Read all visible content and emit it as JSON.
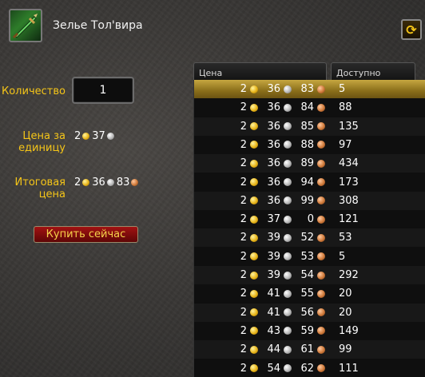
{
  "item": {
    "name": "Зелье Тол'вира",
    "icon": "dagger-icon"
  },
  "form": {
    "quantity_label": "Количество",
    "quantity_value": "1",
    "unit_price_label_1": "Цена за",
    "unit_price_label_2": "единицу",
    "unit_price": {
      "gold": "2",
      "silver": "37"
    },
    "total_label_1": "Итоговая",
    "total_label_2": "цена",
    "total_price": {
      "gold": "2",
      "silver": "36",
      "copper": "83"
    },
    "buy_label": "Купить сейчас"
  },
  "table": {
    "headers": {
      "price": "Цена",
      "available": "Доступно"
    },
    "rows": [
      {
        "gold": "2",
        "silver": "36",
        "copper": "83",
        "available": "5"
      },
      {
        "gold": "2",
        "silver": "36",
        "copper": "84",
        "available": "88"
      },
      {
        "gold": "2",
        "silver": "36",
        "copper": "85",
        "available": "135"
      },
      {
        "gold": "2",
        "silver": "36",
        "copper": "88",
        "available": "97"
      },
      {
        "gold": "2",
        "silver": "36",
        "copper": "89",
        "available": "434"
      },
      {
        "gold": "2",
        "silver": "36",
        "copper": "94",
        "available": "173"
      },
      {
        "gold": "2",
        "silver": "36",
        "copper": "99",
        "available": "308"
      },
      {
        "gold": "2",
        "silver": "37",
        "copper": "0",
        "available": "121"
      },
      {
        "gold": "2",
        "silver": "39",
        "copper": "52",
        "available": "53"
      },
      {
        "gold": "2",
        "silver": "39",
        "copper": "53",
        "available": "5"
      },
      {
        "gold": "2",
        "silver": "39",
        "copper": "54",
        "available": "292"
      },
      {
        "gold": "2",
        "silver": "41",
        "copper": "55",
        "available": "20"
      },
      {
        "gold": "2",
        "silver": "41",
        "copper": "56",
        "available": "20"
      },
      {
        "gold": "2",
        "silver": "43",
        "copper": "59",
        "available": "149"
      },
      {
        "gold": "2",
        "silver": "44",
        "copper": "61",
        "available": "99"
      },
      {
        "gold": "2",
        "silver": "54",
        "copper": "62",
        "available": "111"
      }
    ],
    "selected_row": 0
  },
  "colors": {
    "label_gold": "#f5c518",
    "button_red": "#a11212",
    "selected_row": "#c6a740"
  }
}
